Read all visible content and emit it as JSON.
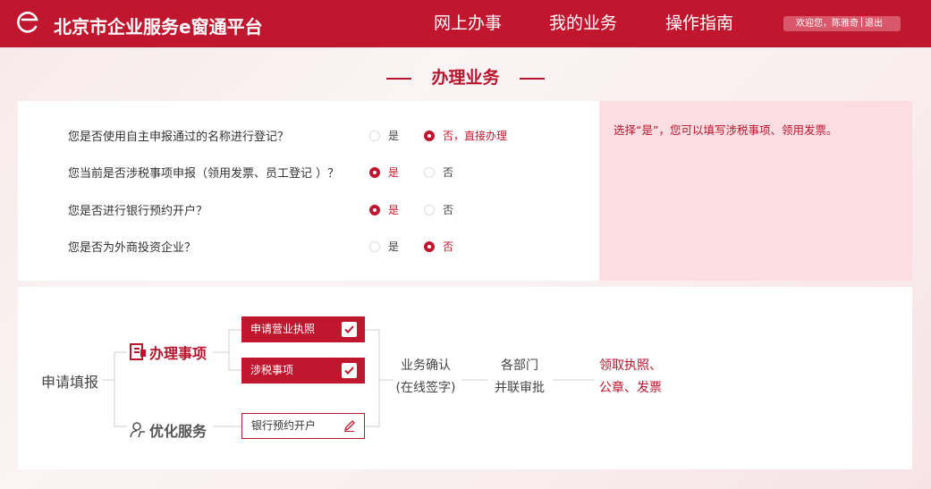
{
  "header": {
    "brand": "北京市企业服务e窗通平台",
    "nav": [
      "网上办事",
      "我的业务",
      "操作指南"
    ],
    "welcome": "欢迎您，陈雅奇",
    "logout": "退出",
    "colors": {
      "primary": "#c0172f"
    }
  },
  "section_title": "办理业务",
  "questions": [
    {
      "text": "您是否使用自主申报通过的名称进行登记？",
      "options": [
        "是",
        "否，直接办理"
      ],
      "selected": 1
    },
    {
      "text": "您当前是否涉税事项申报（领用发票、员工登记 ）？",
      "options": [
        "是",
        "否"
      ],
      "selected": 0
    },
    {
      "text": "您是否进行银行预约开户？",
      "options": [
        "是",
        "否"
      ],
      "selected": 0
    },
    {
      "text": "您是否为外商投资企业？",
      "options": [
        "是",
        "否"
      ],
      "selected": 1
    }
  ],
  "tip": "选择“是”，您可以填写涉税事项、领用发票。",
  "flow": {
    "start": "申请填报",
    "group1": {
      "label": "办理事项",
      "icon": "document-icon"
    },
    "group2": {
      "label": "优化服务",
      "icon": "service-icon"
    },
    "items": [
      {
        "label": "申请营业执照",
        "state": "checked"
      },
      {
        "label": "涉税事项",
        "state": "checked"
      },
      {
        "label": "银行预约开户",
        "state": "edit"
      }
    ],
    "step1": [
      "业务确认",
      "(在线签字)"
    ],
    "step2": [
      "各部门",
      "并联审批"
    ],
    "step3": [
      "领取执照、",
      "公章、发票"
    ]
  }
}
